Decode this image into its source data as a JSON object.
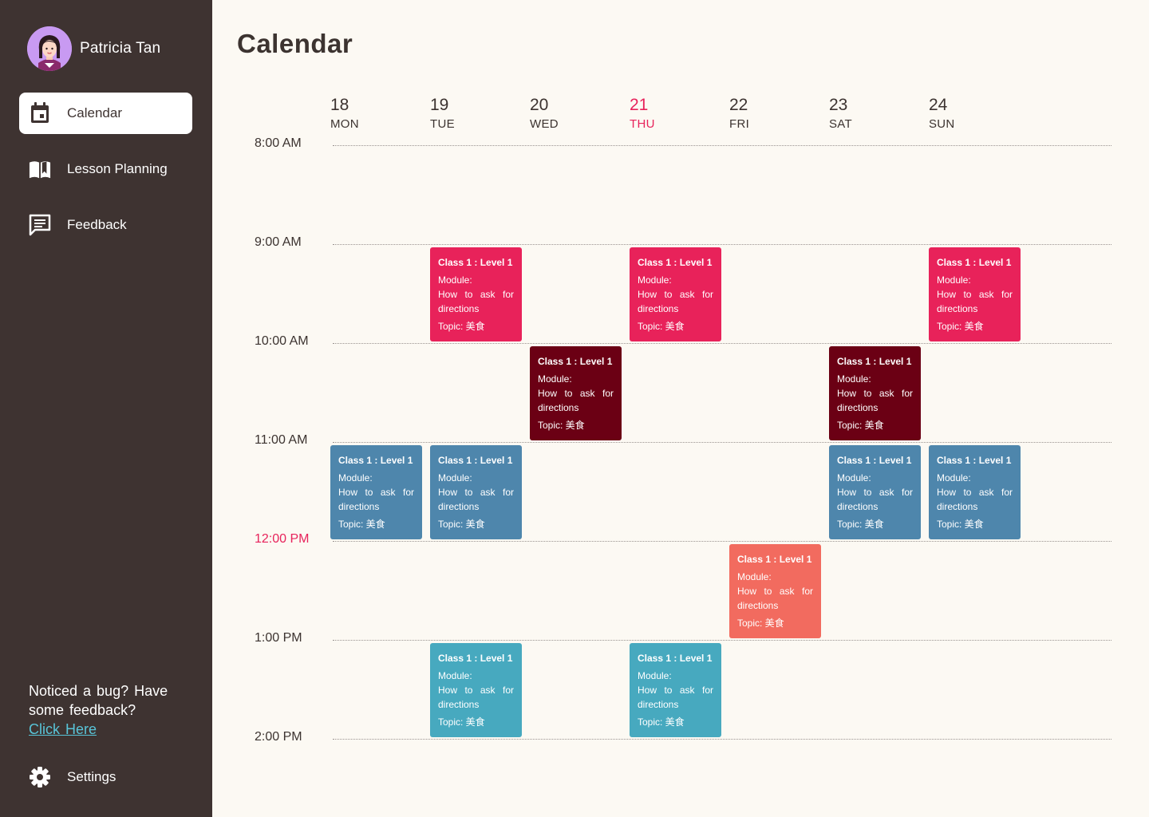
{
  "sidebar": {
    "user_name": "Patricia Tan",
    "nav": [
      {
        "label": "Calendar",
        "icon": "calendar-icon",
        "active": true
      },
      {
        "label": "Lesson Planning",
        "icon": "book-icon",
        "active": false
      },
      {
        "label": "Feedback",
        "icon": "feedback-icon",
        "active": false
      }
    ],
    "bug_text": "Noticed a bug? Have some feedback?",
    "bug_link": "Click Here",
    "settings_label": "Settings"
  },
  "main": {
    "title": "Calendar",
    "days": [
      {
        "num": "18",
        "name": "MON"
      },
      {
        "num": "19",
        "name": "TUE"
      },
      {
        "num": "20",
        "name": "WED"
      },
      {
        "num": "21",
        "name": "THU",
        "today": true
      },
      {
        "num": "22",
        "name": "FRI"
      },
      {
        "num": "23",
        "name": "SAT"
      },
      {
        "num": "24",
        "name": "SUN"
      }
    ],
    "times": [
      "8:00 AM",
      "9:00 AM",
      "10:00 AM",
      "11:00 AM",
      "12:00 PM",
      "1:00 PM",
      "2:00 PM"
    ],
    "current_time": "12:00 PM",
    "events": [
      {
        "day": "19",
        "start": "9:00 AM",
        "title": "Class 1 : Level 1",
        "module": "Module:",
        "desc": "How to ask for directions",
        "topic": "Topic: 美食",
        "color": "#e8225a"
      },
      {
        "day": "21",
        "start": "9:00 AM",
        "title": "Class 1 : Level 1",
        "module": "Module:",
        "desc": "How to ask for directions",
        "topic": "Topic: 美食",
        "color": "#e8225a"
      },
      {
        "day": "24",
        "start": "9:00 AM",
        "title": "Class 1 : Level 1",
        "module": "Module:",
        "desc": "How to ask for directions",
        "topic": "Topic: 美食",
        "color": "#e8225a"
      },
      {
        "day": "20",
        "start": "10:00 AM",
        "title": "Class 1 : Level 1",
        "module": "Module:",
        "desc": "How to ask for directions",
        "topic": "Topic: 美食",
        "color": "#6b0014"
      },
      {
        "day": "23",
        "start": "10:00 AM",
        "title": "Class 1 : Level 1",
        "module": "Module:",
        "desc": "How to ask for directions",
        "topic": "Topic: 美食",
        "color": "#6b0014"
      },
      {
        "day": "18",
        "start": "11:00 AM",
        "title": "Class 1 : Level 1",
        "module": "Module:",
        "desc": "How to ask for directions",
        "topic": "Topic: 美食",
        "color": "#4e86ac"
      },
      {
        "day": "19",
        "start": "11:00 AM",
        "title": "Class 1 : Level 1",
        "module": "Module:",
        "desc": "How to ask for directions",
        "topic": "Topic: 美食",
        "color": "#4e86ac"
      },
      {
        "day": "23",
        "start": "11:00 AM",
        "title": "Class 1 : Level 1",
        "module": "Module:",
        "desc": "How to ask for directions",
        "topic": "Topic: 美食",
        "color": "#4e86ac"
      },
      {
        "day": "24",
        "start": "11:00 AM",
        "title": "Class 1 : Level 1",
        "module": "Module:",
        "desc": "How to ask for directions",
        "topic": "Topic: 美食",
        "color": "#4e86ac"
      },
      {
        "day": "22",
        "start": "12:00 PM",
        "title": "Class 1 : Level 1",
        "module": "Module:",
        "desc": "How to ask for directions",
        "topic": "Topic: 美食",
        "color": "#f26b5f"
      },
      {
        "day": "19",
        "start": "1:00 PM",
        "title": "Class 1 : Level 1",
        "module": "Module:",
        "desc": "How to ask for directions",
        "topic": "Topic: 美食",
        "color": "#47a9bf"
      },
      {
        "day": "21",
        "start": "1:00 PM",
        "title": "Class 1 : Level 1",
        "module": "Module:",
        "desc": "How to ask for directions",
        "topic": "Topic: 美食",
        "color": "#47a9bf"
      }
    ]
  }
}
